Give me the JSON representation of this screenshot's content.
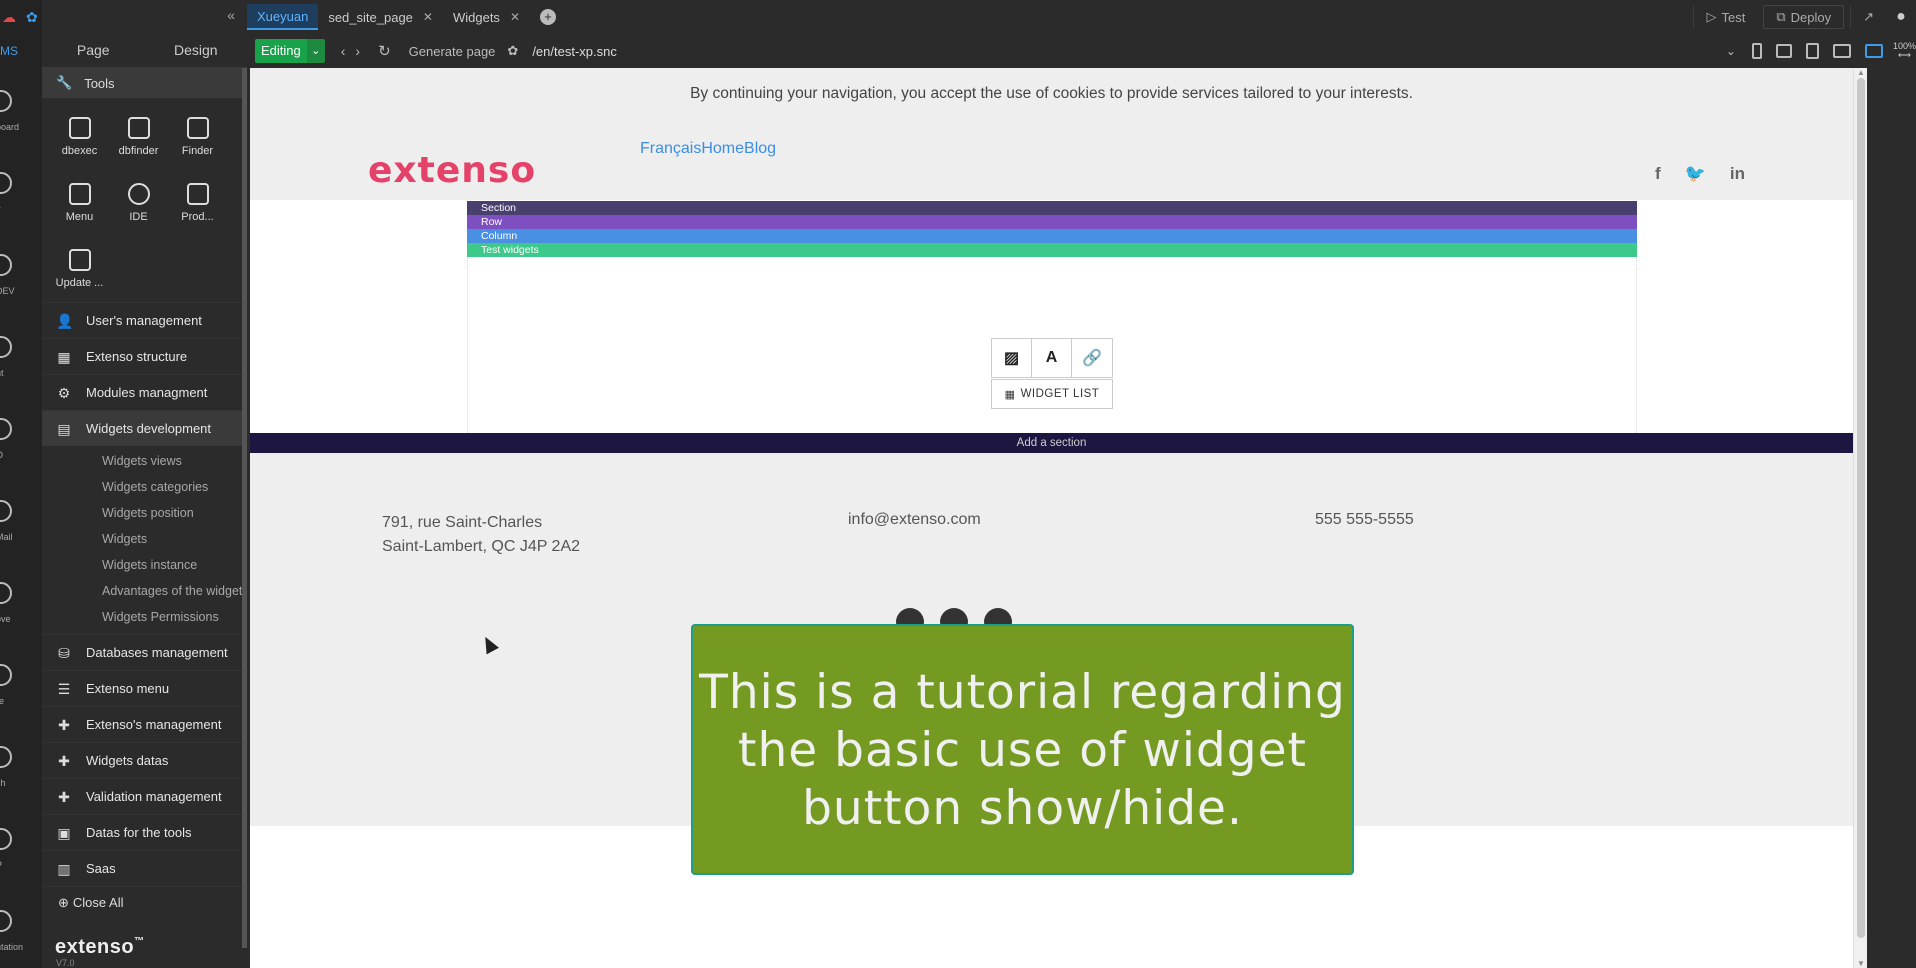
{
  "rail": {
    "cms_label": "MS",
    "items": [
      "board",
      "v",
      "DEV",
      "nt",
      "O",
      "Mail",
      "ove",
      "re",
      "ch",
      "P",
      "ntation"
    ]
  },
  "sidebar": {
    "tabs": [
      "Page",
      "Design"
    ],
    "tools_label": "Tools",
    "tools": [
      {
        "label": "dbexec",
        "icon": "terminal-icon"
      },
      {
        "label": "dbfinder",
        "icon": "database-search-icon"
      },
      {
        "label": "Finder",
        "icon": "folder-search-icon"
      },
      {
        "label": "Menu",
        "icon": "menu-edit-icon"
      },
      {
        "label": "IDE",
        "icon": "code-icon"
      },
      {
        "label": "Prod...",
        "icon": "external-link-icon"
      },
      {
        "label": "Update ...",
        "icon": "file-edit-icon"
      }
    ],
    "menu": [
      {
        "label": "User's management",
        "icon": "user-icon"
      },
      {
        "label": "Extenso structure",
        "icon": "structure-icon"
      },
      {
        "label": "Modules managment",
        "icon": "modules-icon"
      },
      {
        "label": "Widgets development",
        "icon": "widgets-icon"
      }
    ],
    "submenu": [
      "Widgets views",
      "Widgets categories",
      "Widgets position",
      "Widgets",
      "Widgets instance",
      "Advantages of the widget",
      "Widgets Permissions"
    ],
    "menu2": [
      {
        "label": "Databases management",
        "icon": "database-icon"
      },
      {
        "label": "Extenso menu",
        "icon": "list-icon"
      },
      {
        "label": "Extenso's management",
        "icon": "plus-icon"
      },
      {
        "label": "Widgets datas",
        "icon": "plus-icon"
      },
      {
        "label": "Validation management",
        "icon": "plus-icon"
      },
      {
        "label": "Datas for the tools",
        "icon": "tools-data-icon"
      },
      {
        "label": "Saas",
        "icon": "building-icon"
      }
    ],
    "close_all": "Close All",
    "brand": "extenso",
    "brand_tm": "™",
    "version": "V7.0"
  },
  "topbar": {
    "tabs": [
      {
        "label": "Xueyuan",
        "active": true,
        "closable": false
      },
      {
        "label": "sed_site_page",
        "active": false,
        "closable": true
      },
      {
        "label": "Widgets",
        "active": false,
        "closable": true
      }
    ],
    "test_label": "Test",
    "deploy_label": "Deploy"
  },
  "toolbar": {
    "mode": "Editing",
    "generate_page": "Generate page",
    "url": "/en/test-xp.snc",
    "zoom": "100%"
  },
  "page": {
    "cookie_text": "By continuing your navigation, you accept the use of cookies to provide services tailored to your interests.",
    "logo": "extenso",
    "nav": "FrançaisHomeBlog",
    "strips": {
      "section": "Section",
      "row": "Row",
      "column": "Column",
      "widgets": "Test widgets"
    },
    "widget_list": "WIDGET LIST",
    "add_section": "Add a section",
    "footer": {
      "address_line1": "791, rue Saint-Charles",
      "address_line2": "Saint-Lambert, QC J4P 2A2",
      "email": "info@extenso.com",
      "phone": "555 555-5555"
    }
  },
  "overlay": {
    "tutorial_text": "This is a tutorial regarding the basic use of widget button show/hide."
  },
  "colors": {
    "accent": "#3d9be9",
    "editing_green": "#18a34a",
    "logo_pink": "#e44268",
    "section_strip": "#4a4070",
    "row_strip": "#7d4fc0",
    "column_strip": "#4a90e2",
    "widgets_strip": "#3dc98a",
    "tutorial_bg": "#749a21"
  }
}
